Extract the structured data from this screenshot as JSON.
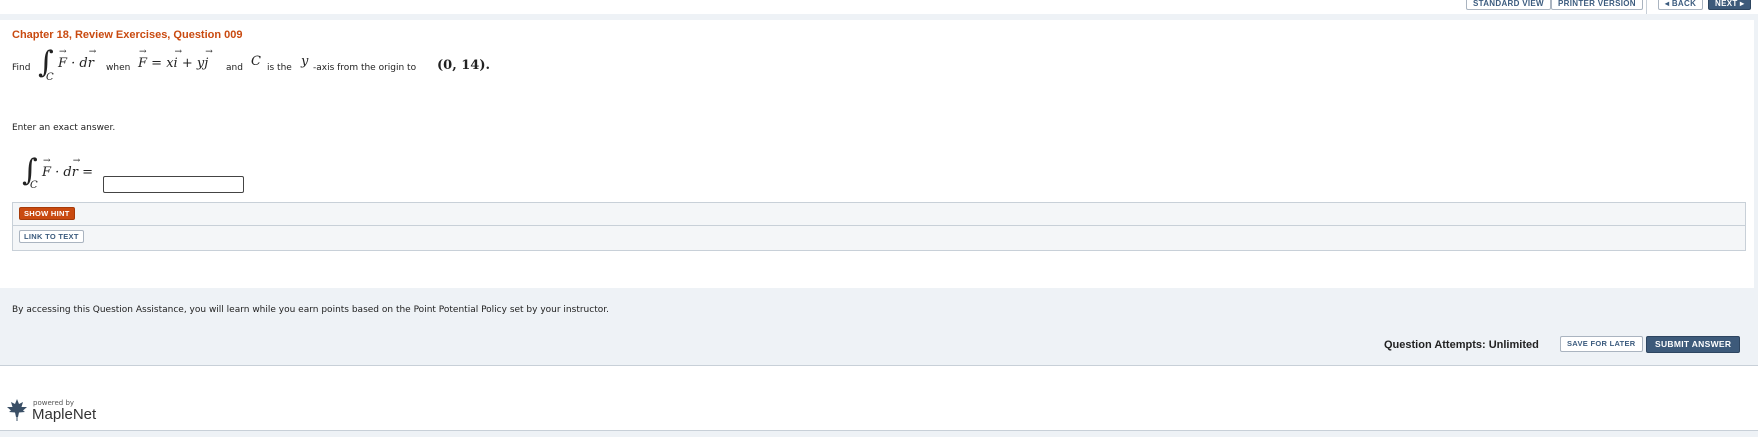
{
  "toolbar": {
    "standard_view": "STANDARD VIEW",
    "printer_version": "PRINTER VERSION",
    "back": "◂ BACK",
    "next": "NEXT ▸"
  },
  "question": {
    "title": "Chapter 18, Review Exercises, Question 009",
    "find": "Find",
    "when": "when",
    "and": "and",
    "is_the": "is the",
    "axis_text": "-axis from the origin to",
    "y_var": "y",
    "c_var": "C",
    "point": "(0, 14).",
    "instruction": "Enter an exact answer.",
    "answer_value": ""
  },
  "buttons": {
    "show_hint": "SHOW HINT",
    "link_to_text": "LINK TO TEXT",
    "save_for_later": "SAVE FOR LATER",
    "submit_answer": "SUBMIT ANSWER"
  },
  "assistance_text": "By accessing this Question Assistance, you will learn while you earn points based on the Point Potential Policy set by your instructor.",
  "attempts": "Question Attempts: Unlimited",
  "footer": {
    "powered_by": "powered by",
    "brand": "MapleNet"
  },
  "colors": {
    "accent_orange": "#c94a10",
    "navy": "#3d5a7a",
    "link_blue": "#3b5b7e"
  },
  "icons": [
    "maple-leaf-icon"
  ]
}
